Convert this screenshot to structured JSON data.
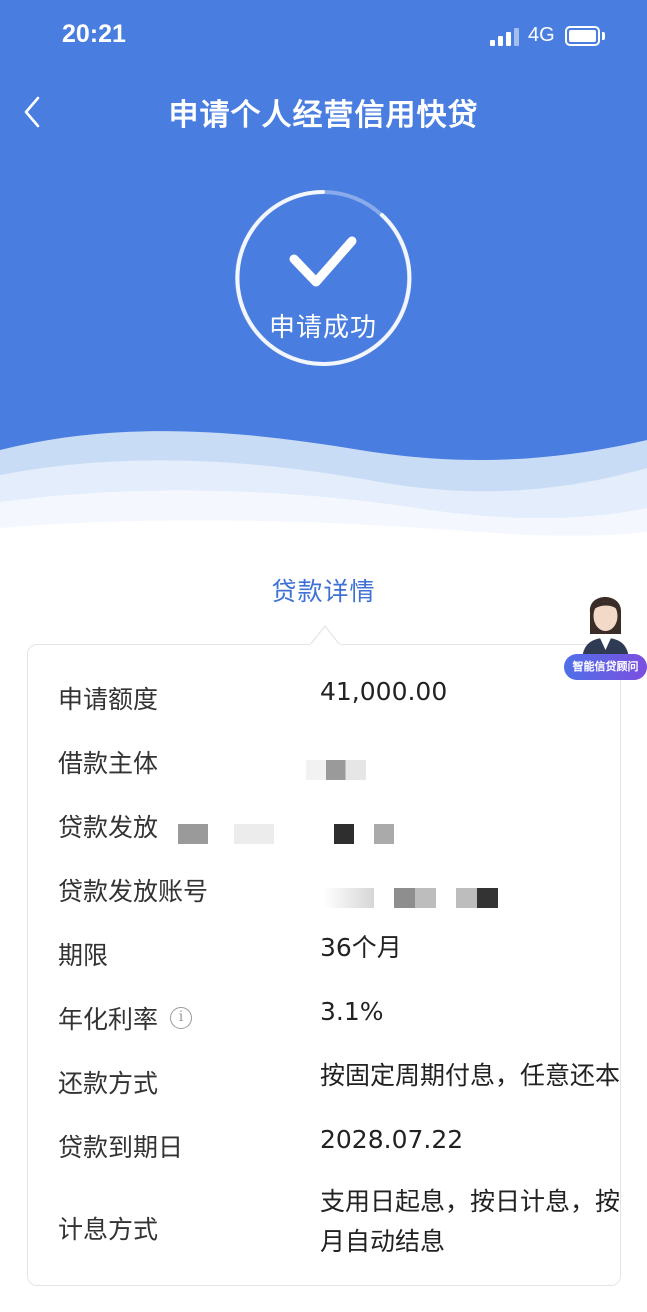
{
  "status_bar": {
    "time": "20:21",
    "network": "4G"
  },
  "header": {
    "title": "申请个人经营信用快贷"
  },
  "result": {
    "label": "申请成功"
  },
  "section": {
    "title": "贷款详情"
  },
  "assistant": {
    "badge": "智能信贷顾问"
  },
  "details": [
    {
      "label": "申请额度",
      "value": "41,000.00"
    },
    {
      "label": "借款主体",
      "value": ""
    },
    {
      "label": "贷款发放",
      "value": ""
    },
    {
      "label": "贷款发放账号",
      "value": ""
    },
    {
      "label": "期限",
      "value": "36个月"
    },
    {
      "label": "年化利率",
      "value": "3.1%"
    },
    {
      "label": "还款方式",
      "value": "按固定周期付息，任意还本"
    },
    {
      "label": "贷款到期日",
      "value": "2028.07.22"
    },
    {
      "label": "计息方式",
      "value": "支用日起息，按日计息，按月自动结息"
    }
  ],
  "colors": {
    "primary_blue": "#4a7de0",
    "link_blue": "#3f72d4"
  }
}
